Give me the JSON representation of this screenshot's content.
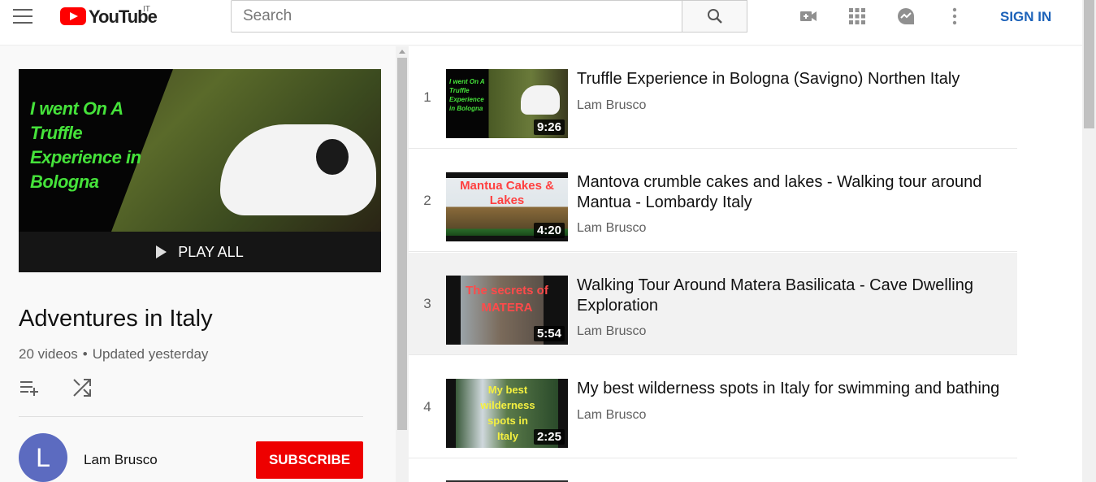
{
  "header": {
    "logo_word": "YouTube",
    "logo_country": "IT",
    "search_placeholder": "Search",
    "sign_in": "SIGN IN"
  },
  "playlist": {
    "thumbnail_caption": "I went On A Truffle Experience in Bologna",
    "play_all": "PLAY ALL",
    "title": "Adventures in Italy",
    "video_count": "20 videos",
    "separator": "•",
    "updated": "Updated yesterday",
    "owner": {
      "initial": "L",
      "name": "Lam Brusco",
      "subscribe": "SUBSCRIBE"
    }
  },
  "videos": [
    {
      "index": "1",
      "title": "Truffle Experience in Bologna (Savigno) Northen Italy",
      "channel": "Lam Brusco",
      "duration": "9:26",
      "thumb_caption": "I went On A Truffle Experience in Bologna"
    },
    {
      "index": "2",
      "title": "Mantova crumble cakes and lakes - Walking tour around Mantua - Lombardy Italy",
      "channel": "Lam Brusco",
      "duration": "4:20",
      "thumb_caption": "Mantua Cakes & Lakes"
    },
    {
      "index": "3",
      "title": "Walking Tour Around Matera Basilicata - Cave Dwelling Exploration",
      "channel": "Lam Brusco",
      "duration": "5:54",
      "thumb_caption": "The secrets of MATERA"
    },
    {
      "index": "4",
      "title": "My best wilderness spots in Italy for swimming and bathing",
      "channel": "Lam Brusco",
      "duration": "2:25",
      "thumb_caption": "My best wilderness spots in Italy"
    }
  ],
  "colors": {
    "brand_red": "#ff0000",
    "subscribe_red": "#ee0000",
    "link_blue": "#1c62b9",
    "avatar": "#5c6bc0"
  }
}
